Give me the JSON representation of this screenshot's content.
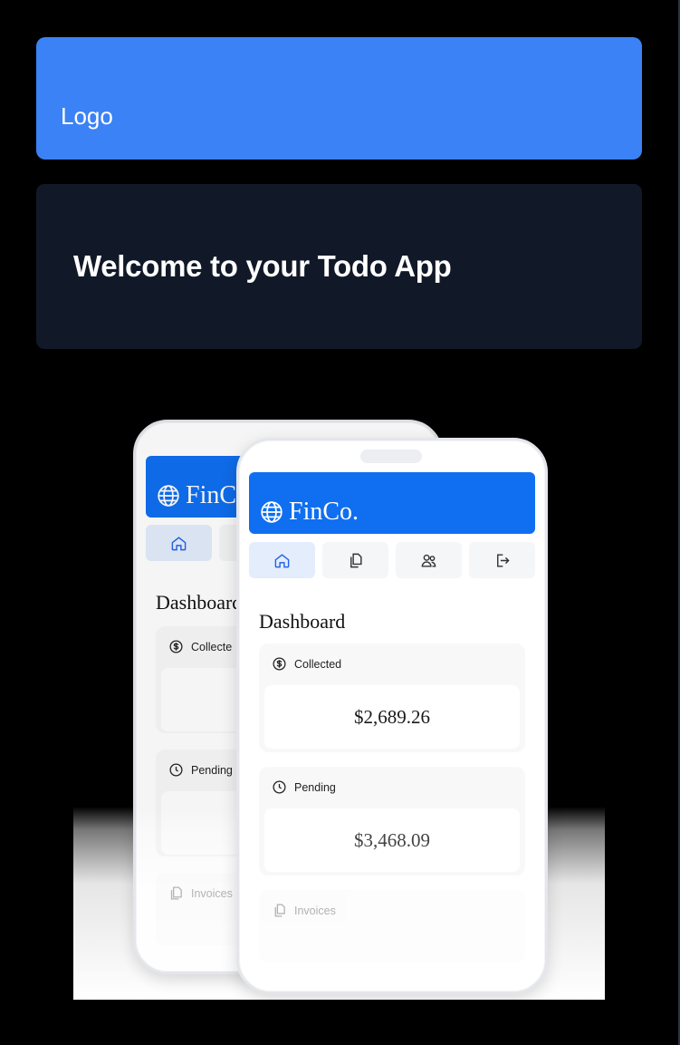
{
  "header": {
    "logo": "Logo"
  },
  "welcome": {
    "title": "Welcome to your Todo App"
  },
  "hero": {
    "back_phone": {
      "brand": "FinC",
      "dashboard": "Dashboard",
      "card1": "Collecte",
      "card2": "Pending",
      "card3": "Invoices"
    },
    "front_phone": {
      "brand": "FinCo.",
      "dashboard": "Dashboard",
      "collected": {
        "label": "Collected",
        "value": "$2,689.26"
      },
      "pending": {
        "label": "Pending",
        "value": "$3,468.09"
      },
      "invoices": {
        "label": "Invoices"
      }
    }
  },
  "colors": {
    "brand_blue": "#3b82f6",
    "panel_dark": "#111827",
    "app_blue": "#0f6ff0"
  }
}
